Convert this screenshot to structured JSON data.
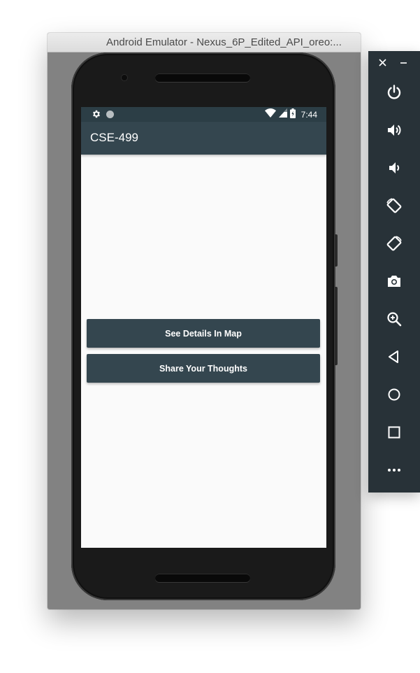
{
  "window": {
    "title": "Android Emulator - Nexus_6P_Edited_API_oreo:..."
  },
  "status_bar": {
    "time": "7:44",
    "icons": [
      "settings-icon",
      "notification-dot-icon",
      "wifi-icon",
      "signal-icon",
      "battery-icon"
    ]
  },
  "app": {
    "title": "CSE-499",
    "buttons": [
      {
        "label": "See Details In Map"
      },
      {
        "label": "Share Your Thoughts"
      }
    ]
  },
  "emulator_toolbar": {
    "items": [
      "close-icon",
      "minimize-icon",
      "power-icon",
      "volume-up-icon",
      "volume-down-icon",
      "rotate-left-icon",
      "rotate-right-icon",
      "camera-icon",
      "zoom-icon",
      "back-icon",
      "home-icon",
      "overview-icon",
      "more-icon"
    ]
  },
  "colors": {
    "primary": "#34464f",
    "primary_dark": "#2c3e46",
    "screen_background": "#fafafa",
    "emulator_toolbar": "#283238"
  }
}
